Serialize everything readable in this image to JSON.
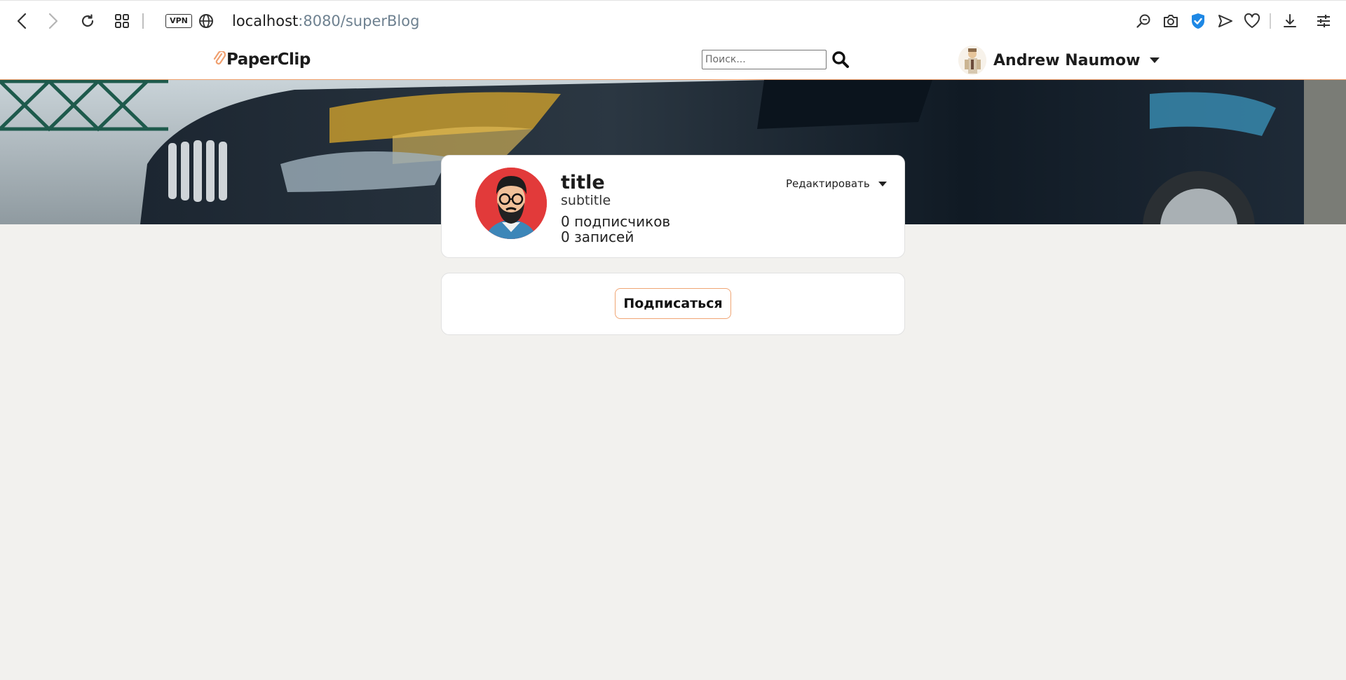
{
  "browser": {
    "vpn_label": "VPN",
    "url_host": "localhost",
    "url_path": ":8080/superBlog",
    "icons": [
      "back-icon",
      "forward-icon",
      "reload-icon",
      "tabs-grid-icon",
      "vpn-badge",
      "globe-icon",
      "zoom-search-icon",
      "camera-icon",
      "shield-check-icon",
      "send-icon",
      "heart-icon",
      "download-icon",
      "settings-sliders-icon"
    ]
  },
  "header": {
    "logo_text": "PaperClip",
    "search_placeholder": "Поиск...",
    "user_name": "Andrew Naumow",
    "accent_color": "#f2a06b"
  },
  "profile": {
    "title": "title",
    "subtitle": "subtitle",
    "subscribers": "0 подписчиков",
    "posts": "0 записей",
    "edit_label": "Редактировать"
  },
  "actions": {
    "subscribe_label": "Подписаться"
  }
}
